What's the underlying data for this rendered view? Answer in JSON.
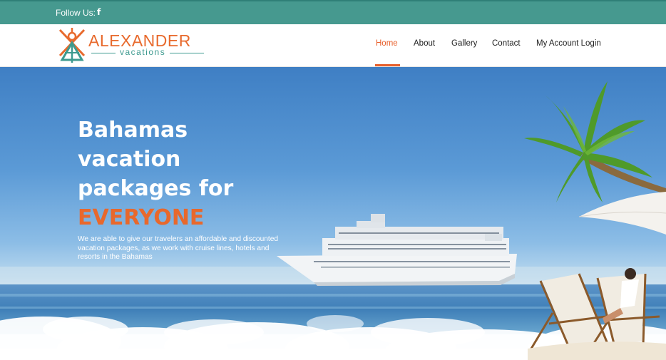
{
  "topbar": {
    "follow_label": "Follow Us:",
    "facebook_glyph": "f"
  },
  "logo": {
    "brand": "ALEXANDER",
    "sub": "vacations",
    "icon": "anchor-cross-icon",
    "colors": {
      "orange": "#e86a2d",
      "teal": "#3d9a8f"
    }
  },
  "nav": {
    "items": [
      {
        "label": "Home",
        "active": true
      },
      {
        "label": "About",
        "active": false
      },
      {
        "label": "Gallery",
        "active": false
      },
      {
        "label": "Contact",
        "active": false
      },
      {
        "label": "My Account Login",
        "active": false
      }
    ]
  },
  "hero": {
    "headline_line1": "Bahamas",
    "headline_line2": "vacation",
    "headline_line3": "packages for",
    "headline_accent": "EVERYONE",
    "tagline": "We are able to give our travelers an affordable and discounted vacation packages, as we work with cruise lines, hotels and resorts in the Bahamas"
  },
  "colors": {
    "topbar": "#46998f",
    "accent": "#e8602c",
    "nav_text": "#222222"
  }
}
